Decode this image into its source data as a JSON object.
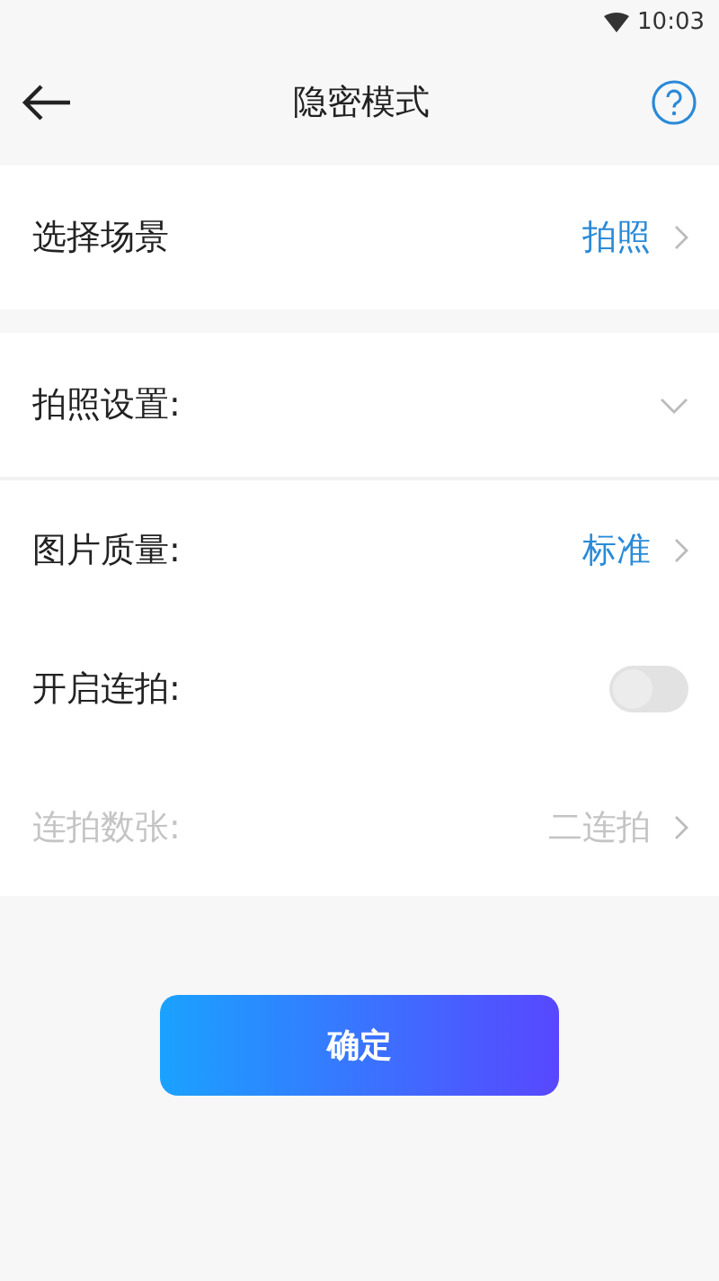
{
  "status_bar": {
    "time": "10:03"
  },
  "header": {
    "title": "隐密模式"
  },
  "scene": {
    "label": "选择场景",
    "value": "拍照"
  },
  "settings": [
    {
      "kind": "dropdown",
      "label": "拍照设置:",
      "expanded": false
    },
    {
      "kind": "nav",
      "label": "图片质量:",
      "value": "标准",
      "disabled": false
    },
    {
      "kind": "toggle",
      "label": "开启连拍:",
      "on": false
    },
    {
      "kind": "nav",
      "label": "连拍数张:",
      "value": "二连拍",
      "disabled": true
    }
  ],
  "confirm_button": "确定"
}
